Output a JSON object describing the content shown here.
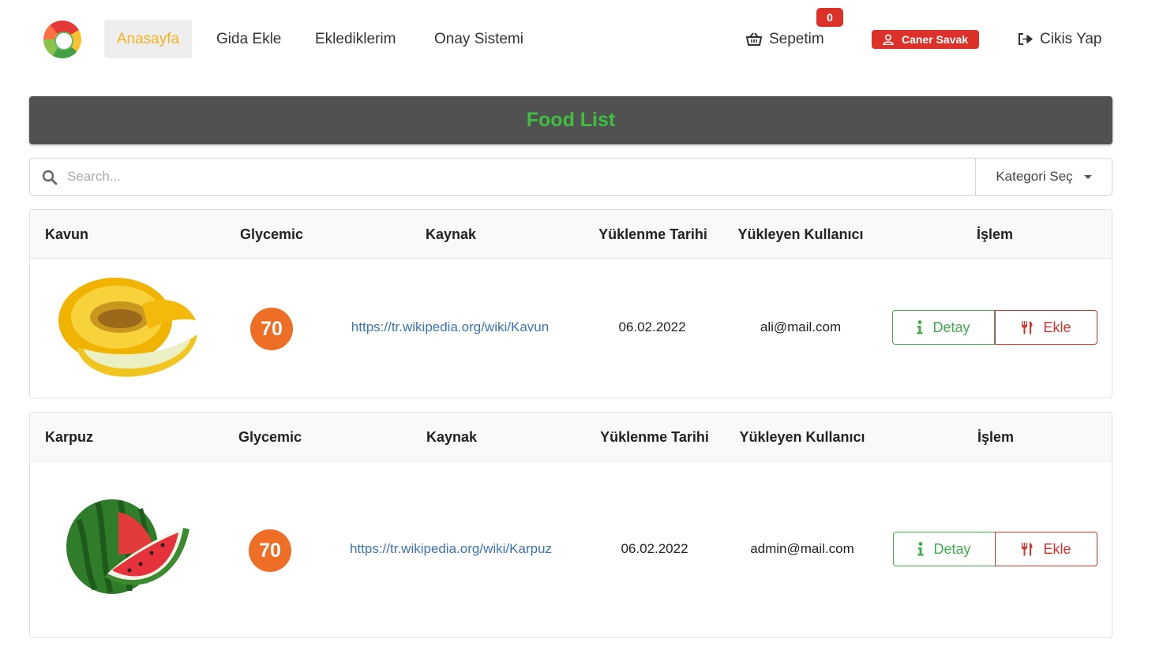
{
  "nav": {
    "links": [
      "Anasayfa",
      "Gida Ekle",
      "Eklediklerim",
      "Onay Sistemi"
    ],
    "cart_label": "Sepetim",
    "cart_count": "0",
    "user_name": "Caner Savak",
    "logout_label": "Cikis Yap"
  },
  "header": {
    "title": "Food List"
  },
  "search": {
    "placeholder": "Search...",
    "category_label": "Kategori Seç"
  },
  "colors": {
    "active_link": "#f5b21f",
    "badge_red": "#dc3129",
    "title_green": "#3fbf3f",
    "gi_orange": "#ee6e26",
    "detay_green": "#3cae4b",
    "ekle_red": "#d9322a"
  },
  "foods": [
    {
      "name": "Kavun",
      "col_glycemic": "Glycemic",
      "col_source": "Kaynak",
      "col_date": "Yüklenme Tarihi",
      "col_user": "Yükleyen Kullanıcı",
      "col_action": "İşlem",
      "glycemic": "70",
      "source": "https://tr.wikipedia.org/wiki/Kavun",
      "date": "06.02.2022",
      "user": "ali@mail.com",
      "detay_label": "Detay",
      "ekle_label": "Ekle"
    },
    {
      "name": "Karpuz",
      "col_glycemic": "Glycemic",
      "col_source": "Kaynak",
      "col_date": "Yüklenme Tarihi",
      "col_user": "Yükleyen Kullanıcı",
      "col_action": "İşlem",
      "glycemic": "70",
      "source": "https://tr.wikipedia.org/wiki/Karpuz",
      "date": "06.02.2022",
      "user": "admin@mail.com",
      "detay_label": "Detay",
      "ekle_label": "Ekle"
    }
  ]
}
